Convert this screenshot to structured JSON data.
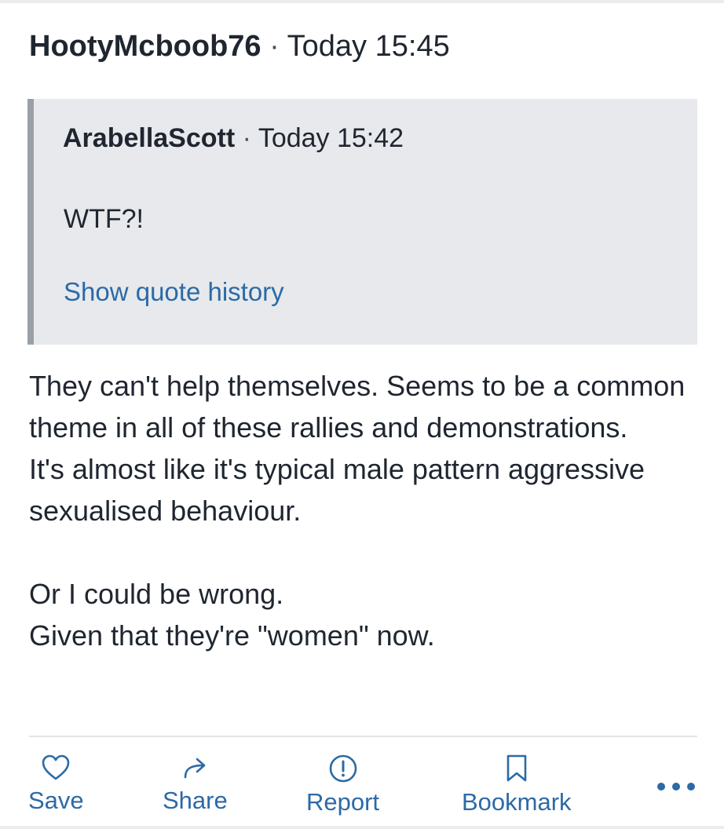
{
  "post": {
    "username": "HootyMcboob76",
    "separator": "·",
    "timestamp": "Today 15:45",
    "quote": {
      "username": "ArabellaScott",
      "separator": "·",
      "timestamp": "Today 15:42",
      "text": "WTF?!",
      "history_link": "Show quote history"
    },
    "body": {
      "line1": "They can't help themselves. Seems to be a common theme in all of these rallies and demonstrations.",
      "line2": "It's almost like it's typical male pattern aggressive sexualised behaviour.",
      "line3": "Or I could be wrong.",
      "line4": "Given that they're \"women\" now."
    }
  },
  "actions": {
    "save": {
      "label": "Save",
      "icon": "heart-icon"
    },
    "share": {
      "label": "Share",
      "icon": "share-arrow-icon"
    },
    "report": {
      "label": "Report",
      "icon": "exclamation-circle-icon"
    },
    "bookmark": {
      "label": "Bookmark",
      "icon": "bookmark-icon"
    },
    "more": {
      "icon": "more-dots-icon"
    }
  },
  "colors": {
    "link": "#2c6aa6",
    "text": "#1f2630",
    "quote_background": "#e7e9ec",
    "quote_border": "#9aa0a8"
  }
}
